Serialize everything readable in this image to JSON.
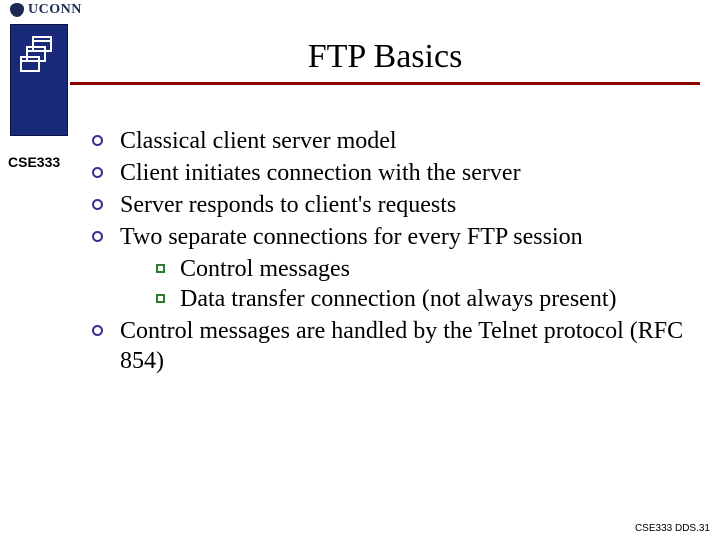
{
  "logo": {
    "text": "UCONN"
  },
  "title": "FTP Basics",
  "sidebar": {
    "course": "CSE333"
  },
  "bullets": [
    {
      "text": "Classical client server model"
    },
    {
      "text": "Client initiates connection with the server"
    },
    {
      "text": "Server responds to client's requests"
    },
    {
      "text": "Two separate connections for every FTP session",
      "sub": [
        {
          "text": "Control messages"
        },
        {
          "text": "Data transfer connection (not always present)"
        }
      ]
    },
    {
      "text": "Control messages are handled by the Telnet protocol (RFC 854)"
    }
  ],
  "footer": "CSE333 DDS.31"
}
